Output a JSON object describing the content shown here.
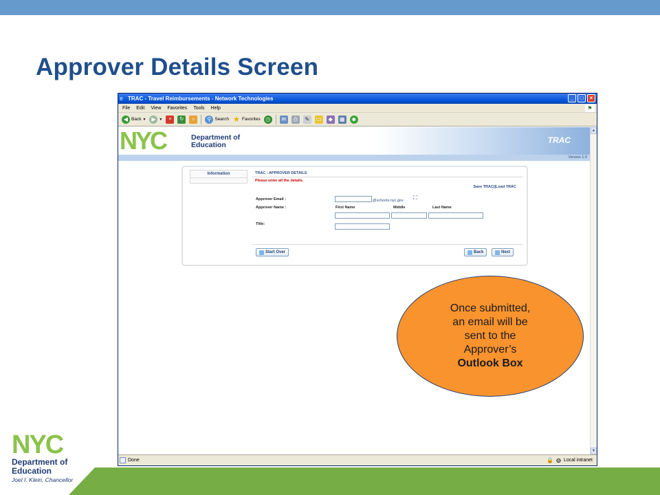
{
  "slide": {
    "title": "Approver Details Screen",
    "colors": {
      "title": "#1f4e8c",
      "top_bar": "#6699cc",
      "green_bar": "#77ad45",
      "callout": "#f9932e"
    }
  },
  "logo": {
    "nyc": "NYC",
    "dept_line1": "Department of",
    "dept_line2": "Education",
    "chancellor": "Joel I. Klein, Chancellor"
  },
  "browser": {
    "title": "TRAC - Travel Reimbursements - Network Technologies",
    "menu": [
      "File",
      "Edit",
      "View",
      "Favorites",
      "Tools",
      "Help"
    ],
    "toolbar": {
      "back_label": "Back",
      "search_label": "Search",
      "favorites_label": "Favorites"
    },
    "status": {
      "done": "Done",
      "zone": "Local intranet"
    }
  },
  "page": {
    "header": {
      "nyc": "NYC",
      "dept_line1": "Department of",
      "dept_line2": "Education",
      "app_name": "TRAC",
      "version": "Version 1.0"
    },
    "sidebar": {
      "tab_label": "Information"
    },
    "form": {
      "heading": "TRAC - APPROVER DETAILS",
      "message": "Please enter all the details.",
      "links": "Save TRAC||Load TRAC",
      "email_label": "Approver Email :",
      "email_value": "",
      "email_domain": "@schools.nyc.gov",
      "name_label": "Approver Name :",
      "first_name_label": "First Name",
      "middle_label": "Middle",
      "last_name_label": "Last Name",
      "first_name_value": "",
      "middle_value": "",
      "last_name_value": "",
      "title_label": "Title:",
      "title_value": "",
      "start_over_label": "Start Over",
      "back_label": "Back",
      "next_label": "Next"
    }
  },
  "callout": {
    "line1": "Once submitted,",
    "line2": "an email will be",
    "line3": "sent to the",
    "line4": "Approver’s",
    "line5": "Outlook Box"
  }
}
